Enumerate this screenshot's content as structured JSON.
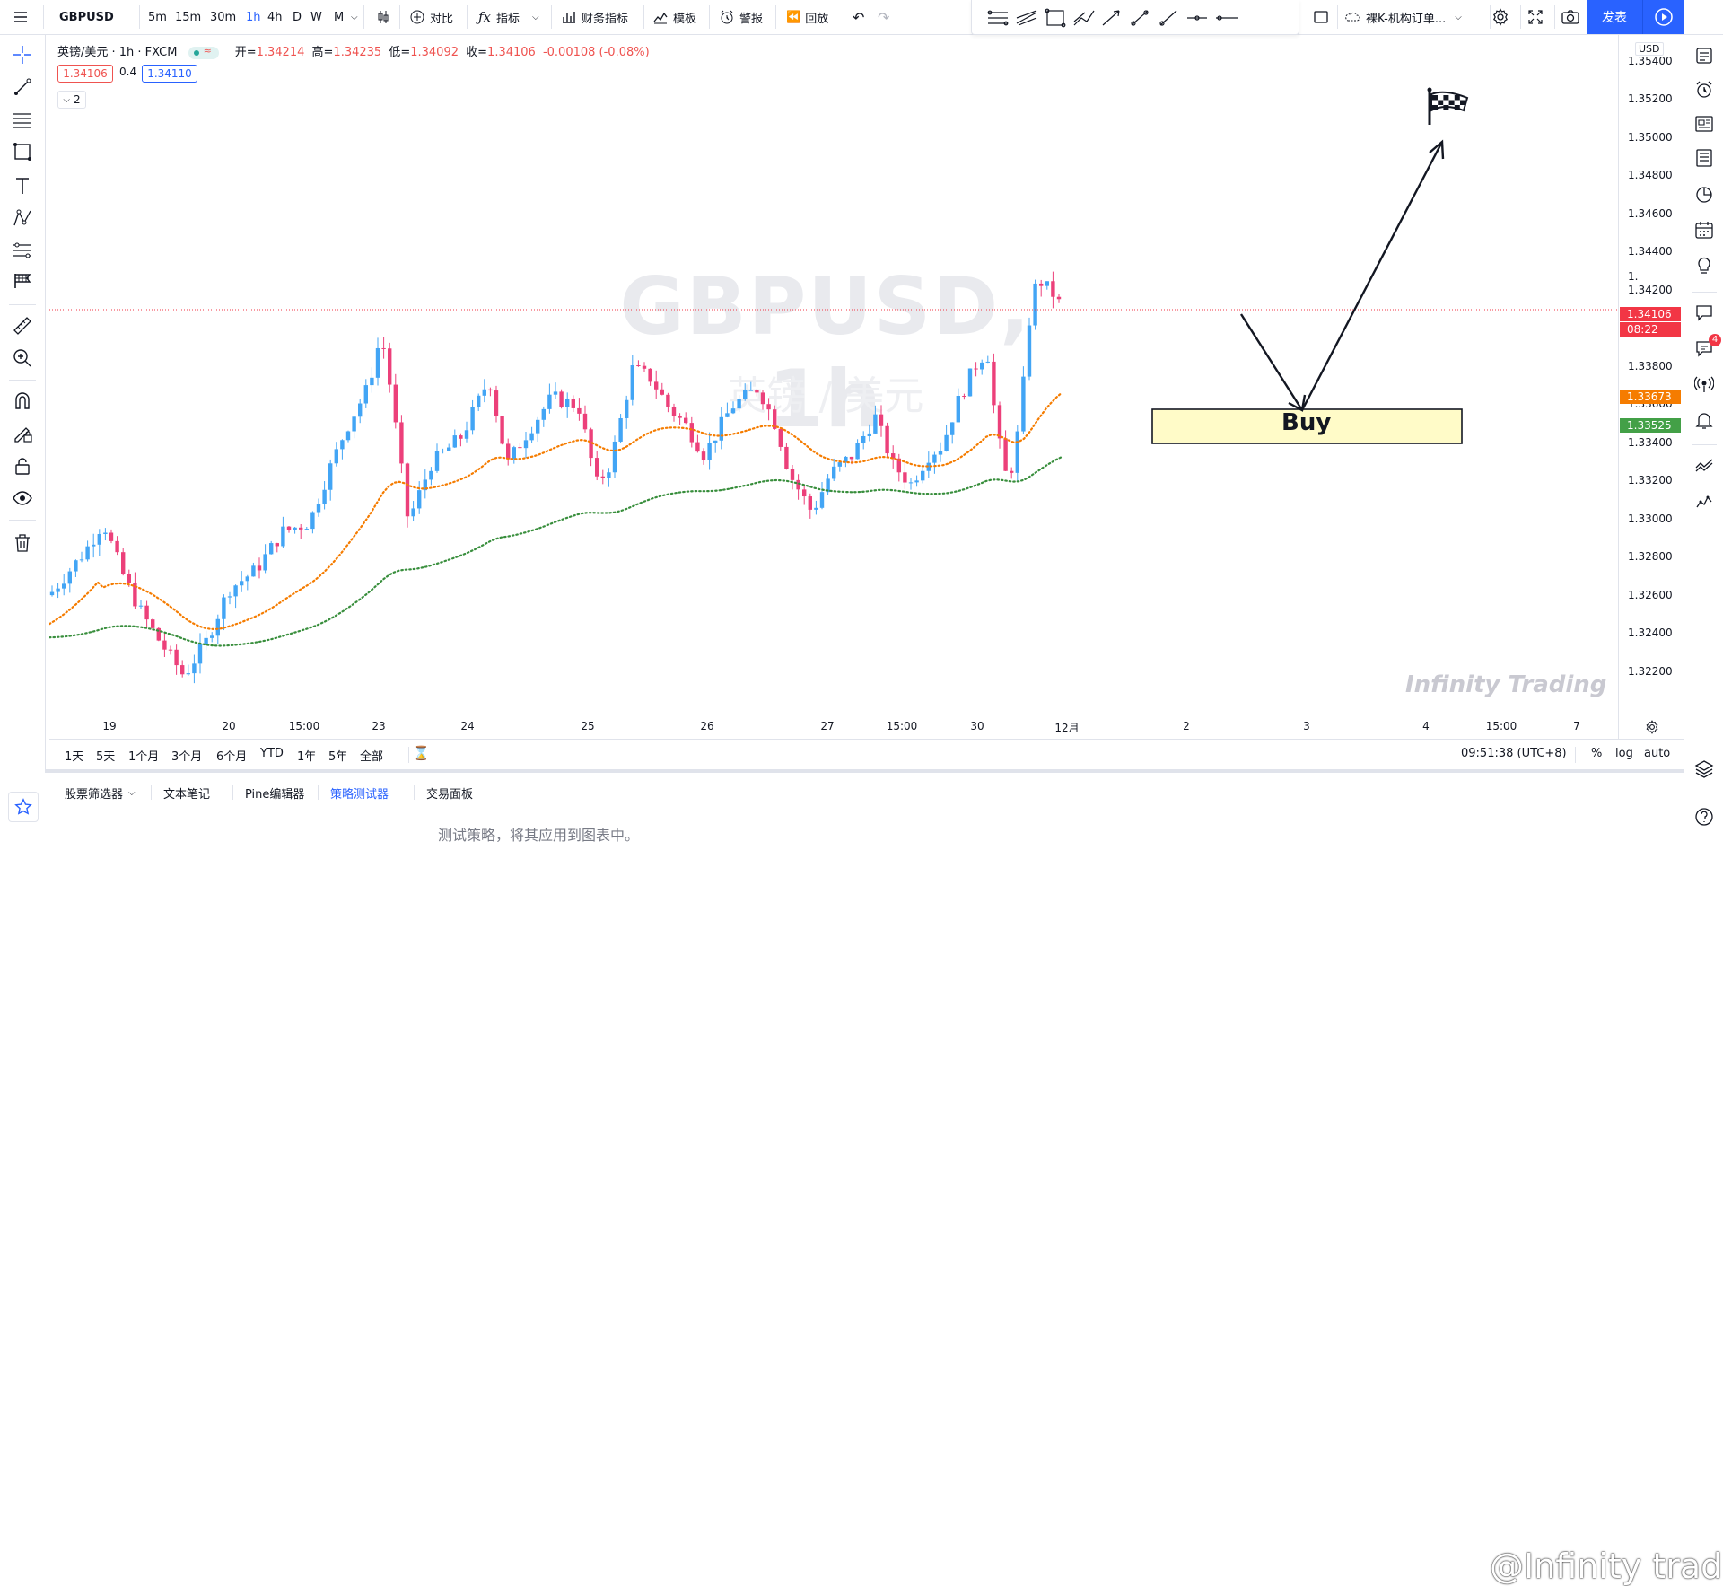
{
  "topbar": {
    "symbol": "GBPUSD",
    "timeframes": [
      "5m",
      "15m",
      "30m",
      "1h",
      "4h",
      "D",
      "W",
      "M"
    ],
    "active_timeframe": "1h",
    "compare_label": "对比",
    "indicators_label": "指标",
    "financials_label": "财务指标",
    "templates_label": "模板",
    "alert_label": "警报",
    "replay_label": "回放",
    "layout_name": "裸K-机构订单...",
    "publish_label": "发表"
  },
  "legend": {
    "title": "英镑/美元 · 1h · FXCM",
    "open_label": "开=",
    "open": "1.34214",
    "high_label": "高=",
    "high": "1.34235",
    "low_label": "低=",
    "low": "1.34092",
    "close_label": "收=",
    "close": "1.34106",
    "change": "-0.00108 (-0.08%)",
    "bid": "1.34106",
    "spread": "0.4",
    "ask": "1.34110",
    "collapse": "2"
  },
  "watermark": {
    "symbol": "GBPUSD, 1h",
    "name": "英镑 / 美元"
  },
  "price_axis": {
    "currency": "USD",
    "labels": [
      "1.35400",
      "1.35200",
      "1.35000",
      "1.34800",
      "1.34600",
      "1.34400",
      "1.34200",
      "1.33800",
      "1.33600",
      "1.33400",
      "1.33200",
      "1.33000",
      "1.32800",
      "1.32600",
      "1.32400",
      "1.32200"
    ],
    "partial_label": "1.",
    "current_price": "1.34106",
    "countdown": "08:22",
    "ema_fast": "1.33673",
    "ema_slow": "1.33525",
    "colors": {
      "current": "#f23645",
      "ema_fast": "#f57c00",
      "ema_slow": "#43a047"
    }
  },
  "time_axis": {
    "labels": [
      "19",
      "20",
      "15:00",
      "23",
      "24",
      "25",
      "26",
      "27",
      "15:00",
      "30",
      "12月",
      "2",
      "3",
      "4",
      "15:00",
      "7"
    ]
  },
  "annotations": {
    "buy_label": "Buy",
    "brand": "Infinity Trading",
    "watermark_handle": "@Infinity trading"
  },
  "range_bar": {
    "ranges": [
      "1天",
      "5天",
      "1个月",
      "3个月",
      "6个月",
      "YTD",
      "1年",
      "5年",
      "全部"
    ],
    "clock": "09:51:38 (UTC+8)",
    "percent": "%",
    "log": "log",
    "auto": "auto"
  },
  "bottom_panel": {
    "tabs": [
      "股票筛选器",
      "文本笔记",
      "Pine编辑器",
      "策略测试器",
      "交易面板"
    ],
    "active_tab": "策略测试器",
    "message": "测试策略，将其应用到图表中。"
  },
  "right_sidebar": {
    "notification_count": "4"
  },
  "colors": {
    "accent": "#2962ff",
    "up_candle": "#42a5f5",
    "down_candle": "#ec407a",
    "ema_fast": "#f57c00",
    "ema_slow": "#388e3c",
    "buy_zone_fill": "#fffbc8"
  }
}
